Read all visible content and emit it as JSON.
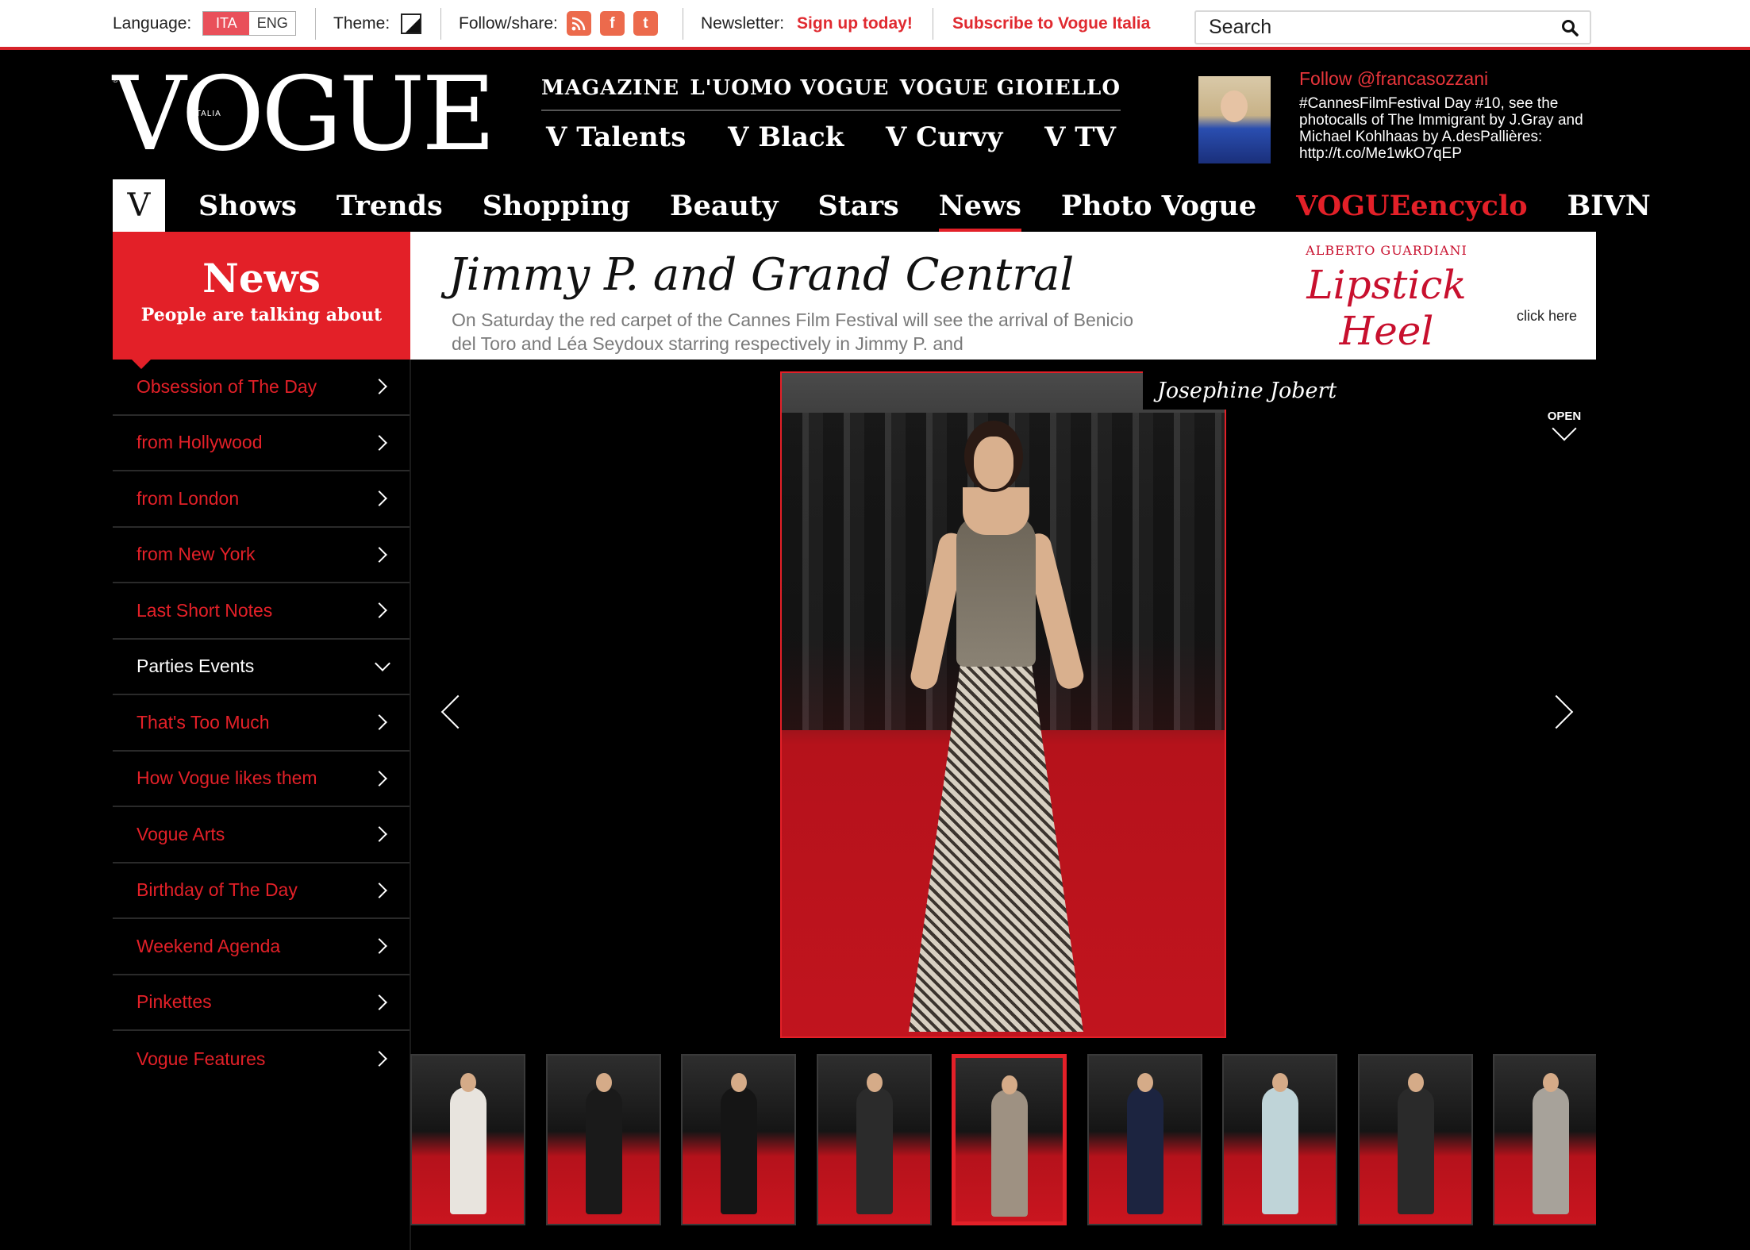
{
  "topbar": {
    "language_label": "Language:",
    "lang_ita": "ITA",
    "lang_eng": "ENG",
    "theme_label": "Theme:",
    "follow_label": "Follow/share:",
    "rss": "rss-icon",
    "facebook_glyph": "f",
    "twitter_glyph": "t",
    "newsletter_label": "Newsletter:",
    "signup": "Sign up today!",
    "subscribe": "Subscribe to Vogue Italia",
    "search_placeholder": "Search"
  },
  "logo": {
    "word": "VOGUE",
    "italia": "ITALIA",
    "reg": "®"
  },
  "magazines": {
    "row1": [
      "MAGAZINE",
      "L'UOMO VOGUE",
      "VOGUE GIOIELLO"
    ],
    "row2": [
      "V Talents",
      "V Black",
      "V Curvy",
      "V TV"
    ]
  },
  "tweet": {
    "follow": "Follow @francasozzani",
    "text": "#CannesFilmFestival Day #10, see the photocalls of The Immigrant by J.Gray and Michael Kohlhaas by A.desPallières: http://t.co/Me1wkO7qEP"
  },
  "nav": {
    "v": "V",
    "items": [
      "Shows",
      "Trends",
      "Shopping",
      "Beauty",
      "Stars",
      "News",
      "Photo Vogue",
      "VOGUEencyclo",
      "BIVN"
    ],
    "active": "News",
    "highlight": "VOGUEencyclo"
  },
  "banner": {
    "section_title": "News",
    "section_subtitle": "People are talking about",
    "headline": "Jimmy P. and Grand Central",
    "summary": "On Saturday the red carpet of the Cannes Film Festival will see the arrival of Benicio del Toro and Léa Seydoux starring respectively in Jimmy P. and",
    "ad_brand": "ALBERTO GUARDIANI",
    "ad_script": "Lipstick Heel",
    "ad_cta": "click here"
  },
  "sidebar": {
    "items": [
      "Obsession of The Day",
      "from Hollywood",
      "from London",
      "from New York",
      "Last Short Notes",
      "Parties Events",
      "That's Too Much",
      "How Vogue likes them",
      "Vogue Arts",
      "Birthday of The Day",
      "Weekend Agenda",
      "Pinkettes",
      "Vogue Features"
    ],
    "open_item": "Parties Events"
  },
  "gallery": {
    "caption": "Josephine Jobert",
    "open_label": "OPEN",
    "thumb_count": 9,
    "active_thumb": 5,
    "thumb_colors": [
      "#e8e4de",
      "#1a1a1a",
      "#151515",
      "#2b2b2b",
      "#9e9182",
      "#1c2440",
      "#bfd4d8",
      "#2a2a2a",
      "#a7a29a"
    ]
  },
  "colors": {
    "accent": "#e32028",
    "background": "#000000"
  }
}
